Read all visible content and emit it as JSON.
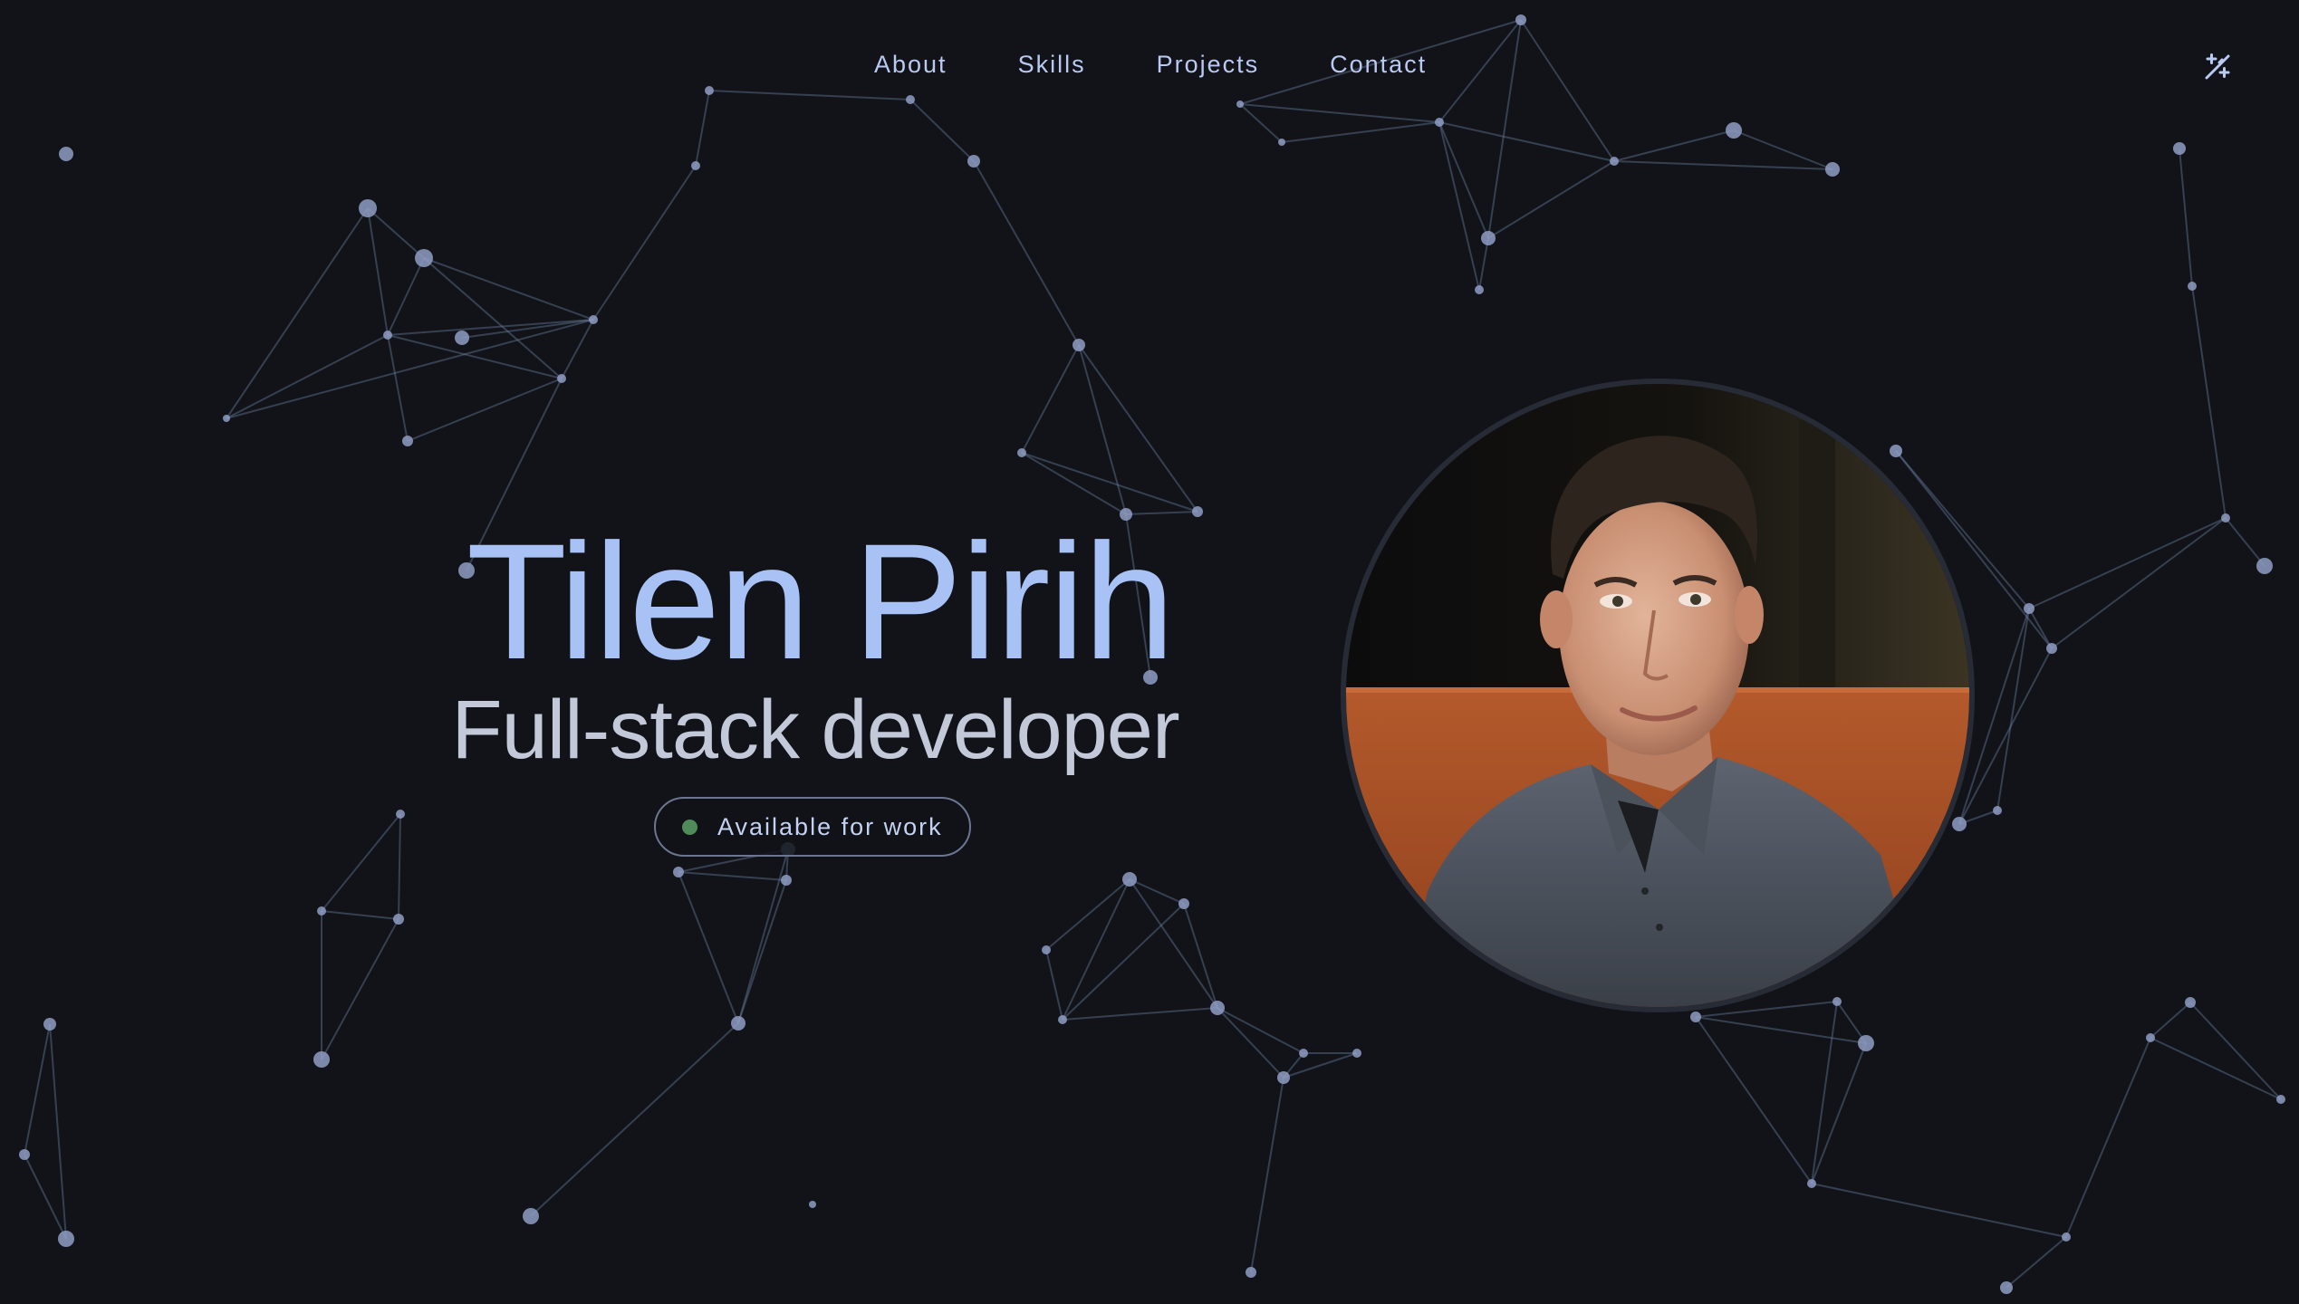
{
  "nav": {
    "items": [
      {
        "label": "About"
      },
      {
        "label": "Skills"
      },
      {
        "label": "Projects"
      },
      {
        "label": "Contact"
      }
    ],
    "theme_toggle_icon": "theme-toggle-icon"
  },
  "hero": {
    "name": "Tilen Pirih",
    "role": "Full-stack developer",
    "status_badge": {
      "label": "Available for work",
      "dot_color": "#4f8a59"
    },
    "portrait_icon": "profile-photo"
  },
  "colors": {
    "background": "#111318",
    "accent": "#a8c2f5",
    "subtitle": "#c3c9d9",
    "network": "#8f9ec3"
  }
}
